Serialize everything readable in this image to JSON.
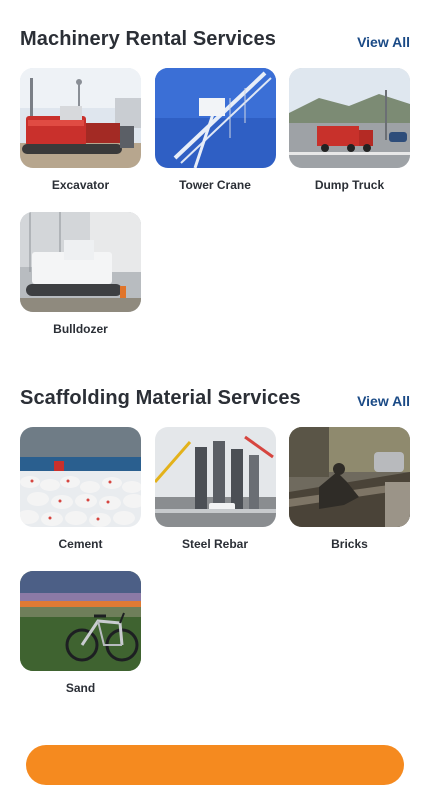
{
  "machinery": {
    "title": "Machinery Rental Services",
    "view_all": "View All",
    "items": [
      {
        "label": "Excavator"
      },
      {
        "label": "Tower Crane"
      },
      {
        "label": "Dump Truck"
      },
      {
        "label": "Bulldozer"
      }
    ]
  },
  "scaffolding": {
    "title": "Scaffolding Material Services",
    "view_all": "View All",
    "items": [
      {
        "label": "Cement"
      },
      {
        "label": "Steel Rebar"
      },
      {
        "label": "Bricks"
      },
      {
        "label": "Sand"
      }
    ]
  },
  "colors": {
    "heading": "#2b2f36",
    "link": "#1a4a86",
    "accent": "#f58a1f"
  }
}
